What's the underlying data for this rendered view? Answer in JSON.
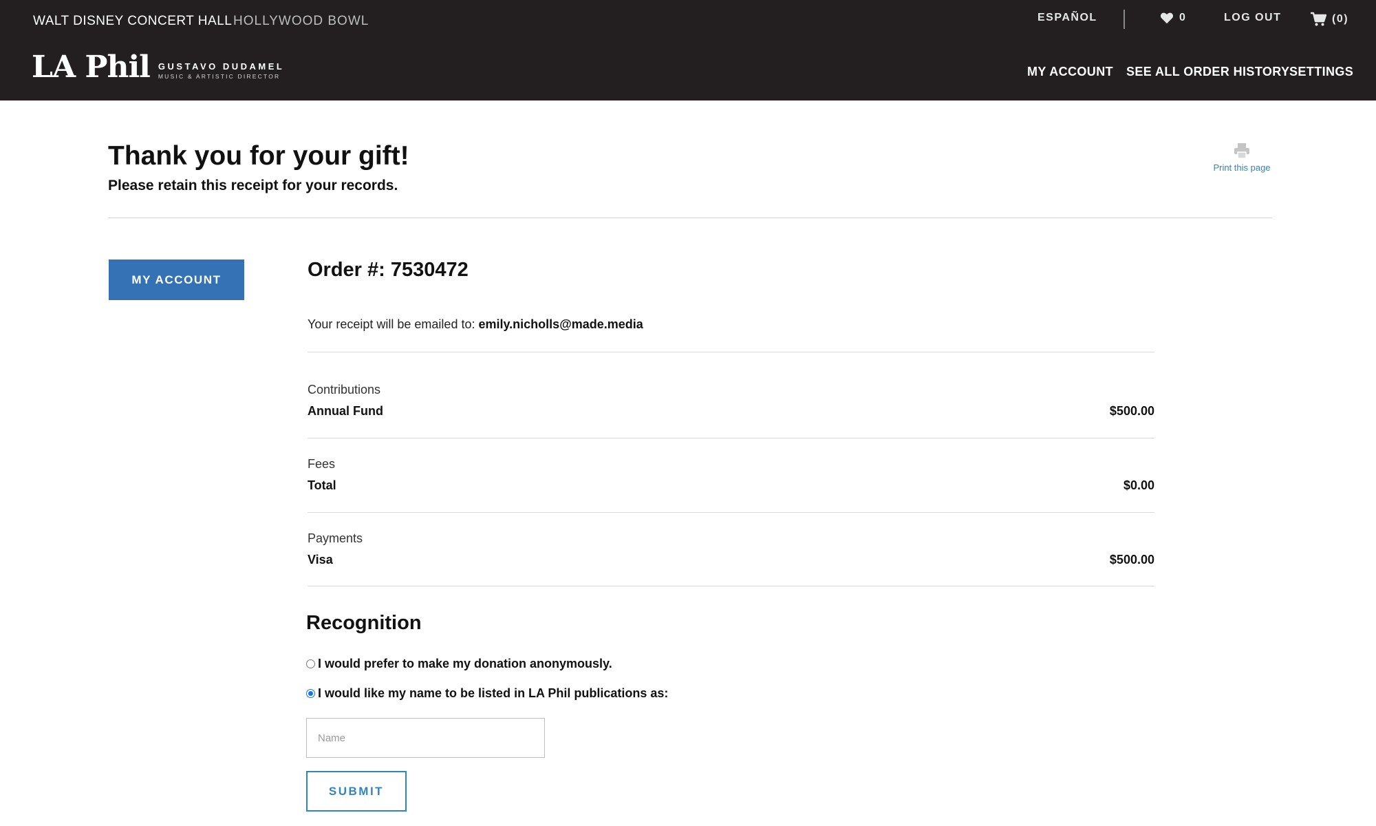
{
  "header": {
    "venues": {
      "wdch": "WALT DISNEY CONCERT HALL",
      "hollywood_bowl": "HOLLYWOOD BOWL"
    },
    "utility": {
      "language": "ESPAÑOL",
      "favorites_count": "0",
      "logout": "LOG OUT",
      "cart_count": "(0)"
    },
    "logo": {
      "mark": "LA Phil",
      "name": "GUSTAVO DUDAMEL",
      "role": "MUSIC & ARTISTIC DIRECTOR"
    },
    "nav": {
      "my_account": "MY ACCOUNT",
      "order_history": "SEE ALL ORDER HISTORY",
      "settings": "SETTINGS"
    }
  },
  "page": {
    "title": "Thank you for your gift!",
    "subtitle": "Please retain this receipt for your records.",
    "print_label": "Print this page"
  },
  "sidebar": {
    "my_account_button": "MY ACCOUNT"
  },
  "order": {
    "number_label": "Order #: 7530472",
    "email_prefix": "Your receipt will be emailed to:",
    "email": "emily.nicholls@made.media",
    "sections": [
      {
        "label": "Contributions",
        "item": "Annual Fund",
        "amount": "$500.00"
      },
      {
        "label": "Fees",
        "item": "Total",
        "amount": "$0.00"
      },
      {
        "label": "Payments",
        "item": "Visa",
        "amount": "$500.00"
      }
    ]
  },
  "recognition": {
    "title": "Recognition",
    "option_anonymous": "I would prefer to make my donation anonymously.",
    "option_named": "I would like my name to be listed in LA Phil publications as:",
    "selected": "named",
    "name_placeholder": "Name",
    "name_value": "",
    "submit_label": "SUBMIT"
  },
  "colors": {
    "header_bg": "#231f20",
    "primary_button": "#3572b5",
    "link_blue": "#2e86c1",
    "radio_selected": "#1a73e8"
  },
  "icons": {
    "favorites": "heart-icon",
    "cart": "cart-icon",
    "print": "printer-icon"
  }
}
